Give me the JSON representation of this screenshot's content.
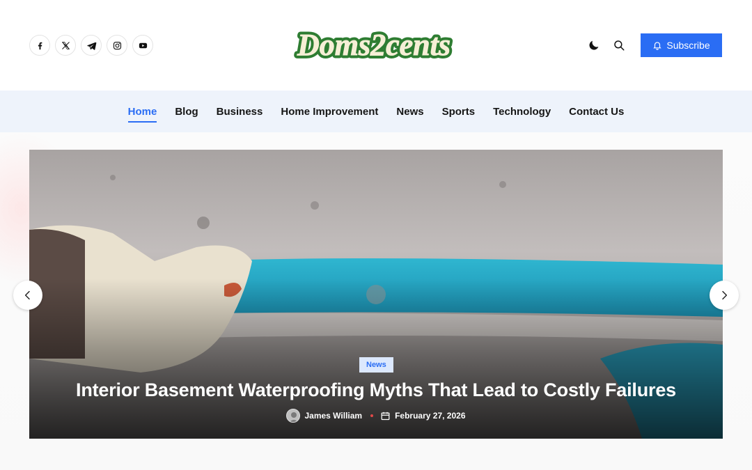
{
  "brand": {
    "logo_text": "Doms2cents",
    "logo_fill": "#f6efd6",
    "logo_stroke": "#2e7d32"
  },
  "header": {
    "socials": [
      {
        "icon": "facebook-icon"
      },
      {
        "icon": "x-twitter-icon"
      },
      {
        "icon": "telegram-icon"
      },
      {
        "icon": "instagram-icon"
      },
      {
        "icon": "youtube-icon"
      }
    ],
    "subscribe_label": "Subscribe",
    "accent": "#2a6df4"
  },
  "nav": {
    "items": [
      {
        "label": "Home",
        "active": true
      },
      {
        "label": "Blog"
      },
      {
        "label": "Business"
      },
      {
        "label": "Home Improvement"
      },
      {
        "label": "News"
      },
      {
        "label": "Sports"
      },
      {
        "label": "Technology"
      },
      {
        "label": "Contact Us"
      }
    ]
  },
  "slider": {
    "category": "News",
    "title": "Interior Basement Waterproofing Myths That Lead to Costly Failures",
    "author": "James William",
    "date": "February 27, 2026"
  }
}
